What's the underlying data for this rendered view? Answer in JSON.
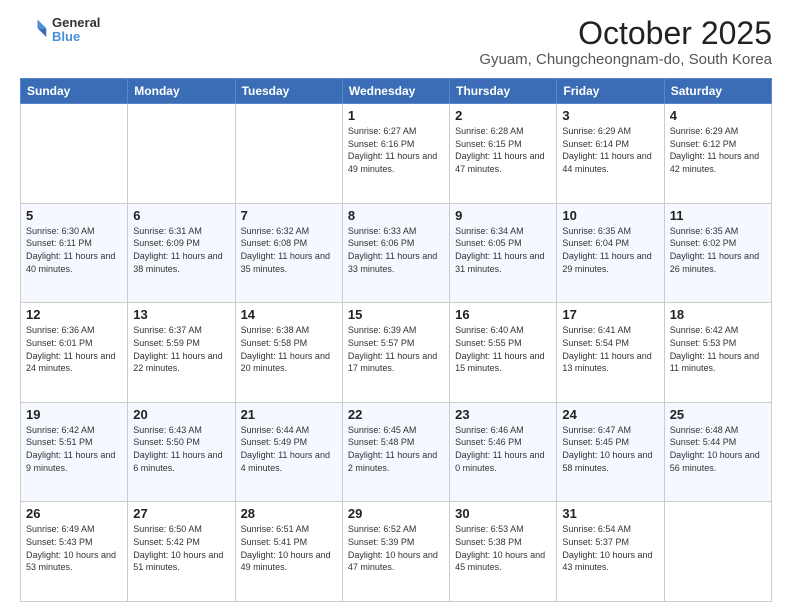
{
  "header": {
    "logo_line1": "General",
    "logo_line2": "Blue",
    "title": "October 2025",
    "subtitle": "Gyuam, Chungcheongnam-do, South Korea"
  },
  "days_of_week": [
    "Sunday",
    "Monday",
    "Tuesday",
    "Wednesday",
    "Thursday",
    "Friday",
    "Saturday"
  ],
  "weeks": [
    [
      {
        "num": "",
        "info": ""
      },
      {
        "num": "",
        "info": ""
      },
      {
        "num": "",
        "info": ""
      },
      {
        "num": "1",
        "info": "Sunrise: 6:27 AM\nSunset: 6:16 PM\nDaylight: 11 hours and 49 minutes."
      },
      {
        "num": "2",
        "info": "Sunrise: 6:28 AM\nSunset: 6:15 PM\nDaylight: 11 hours and 47 minutes."
      },
      {
        "num": "3",
        "info": "Sunrise: 6:29 AM\nSunset: 6:14 PM\nDaylight: 11 hours and 44 minutes."
      },
      {
        "num": "4",
        "info": "Sunrise: 6:29 AM\nSunset: 6:12 PM\nDaylight: 11 hours and 42 minutes."
      }
    ],
    [
      {
        "num": "5",
        "info": "Sunrise: 6:30 AM\nSunset: 6:11 PM\nDaylight: 11 hours and 40 minutes."
      },
      {
        "num": "6",
        "info": "Sunrise: 6:31 AM\nSunset: 6:09 PM\nDaylight: 11 hours and 38 minutes."
      },
      {
        "num": "7",
        "info": "Sunrise: 6:32 AM\nSunset: 6:08 PM\nDaylight: 11 hours and 35 minutes."
      },
      {
        "num": "8",
        "info": "Sunrise: 6:33 AM\nSunset: 6:06 PM\nDaylight: 11 hours and 33 minutes."
      },
      {
        "num": "9",
        "info": "Sunrise: 6:34 AM\nSunset: 6:05 PM\nDaylight: 11 hours and 31 minutes."
      },
      {
        "num": "10",
        "info": "Sunrise: 6:35 AM\nSunset: 6:04 PM\nDaylight: 11 hours and 29 minutes."
      },
      {
        "num": "11",
        "info": "Sunrise: 6:35 AM\nSunset: 6:02 PM\nDaylight: 11 hours and 26 minutes."
      }
    ],
    [
      {
        "num": "12",
        "info": "Sunrise: 6:36 AM\nSunset: 6:01 PM\nDaylight: 11 hours and 24 minutes."
      },
      {
        "num": "13",
        "info": "Sunrise: 6:37 AM\nSunset: 5:59 PM\nDaylight: 11 hours and 22 minutes."
      },
      {
        "num": "14",
        "info": "Sunrise: 6:38 AM\nSunset: 5:58 PM\nDaylight: 11 hours and 20 minutes."
      },
      {
        "num": "15",
        "info": "Sunrise: 6:39 AM\nSunset: 5:57 PM\nDaylight: 11 hours and 17 minutes."
      },
      {
        "num": "16",
        "info": "Sunrise: 6:40 AM\nSunset: 5:55 PM\nDaylight: 11 hours and 15 minutes."
      },
      {
        "num": "17",
        "info": "Sunrise: 6:41 AM\nSunset: 5:54 PM\nDaylight: 11 hours and 13 minutes."
      },
      {
        "num": "18",
        "info": "Sunrise: 6:42 AM\nSunset: 5:53 PM\nDaylight: 11 hours and 11 minutes."
      }
    ],
    [
      {
        "num": "19",
        "info": "Sunrise: 6:42 AM\nSunset: 5:51 PM\nDaylight: 11 hours and 9 minutes."
      },
      {
        "num": "20",
        "info": "Sunrise: 6:43 AM\nSunset: 5:50 PM\nDaylight: 11 hours and 6 minutes."
      },
      {
        "num": "21",
        "info": "Sunrise: 6:44 AM\nSunset: 5:49 PM\nDaylight: 11 hours and 4 minutes."
      },
      {
        "num": "22",
        "info": "Sunrise: 6:45 AM\nSunset: 5:48 PM\nDaylight: 11 hours and 2 minutes."
      },
      {
        "num": "23",
        "info": "Sunrise: 6:46 AM\nSunset: 5:46 PM\nDaylight: 11 hours and 0 minutes."
      },
      {
        "num": "24",
        "info": "Sunrise: 6:47 AM\nSunset: 5:45 PM\nDaylight: 10 hours and 58 minutes."
      },
      {
        "num": "25",
        "info": "Sunrise: 6:48 AM\nSunset: 5:44 PM\nDaylight: 10 hours and 56 minutes."
      }
    ],
    [
      {
        "num": "26",
        "info": "Sunrise: 6:49 AM\nSunset: 5:43 PM\nDaylight: 10 hours and 53 minutes."
      },
      {
        "num": "27",
        "info": "Sunrise: 6:50 AM\nSunset: 5:42 PM\nDaylight: 10 hours and 51 minutes."
      },
      {
        "num": "28",
        "info": "Sunrise: 6:51 AM\nSunset: 5:41 PM\nDaylight: 10 hours and 49 minutes."
      },
      {
        "num": "29",
        "info": "Sunrise: 6:52 AM\nSunset: 5:39 PM\nDaylight: 10 hours and 47 minutes."
      },
      {
        "num": "30",
        "info": "Sunrise: 6:53 AM\nSunset: 5:38 PM\nDaylight: 10 hours and 45 minutes."
      },
      {
        "num": "31",
        "info": "Sunrise: 6:54 AM\nSunset: 5:37 PM\nDaylight: 10 hours and 43 minutes."
      },
      {
        "num": "",
        "info": ""
      }
    ]
  ]
}
